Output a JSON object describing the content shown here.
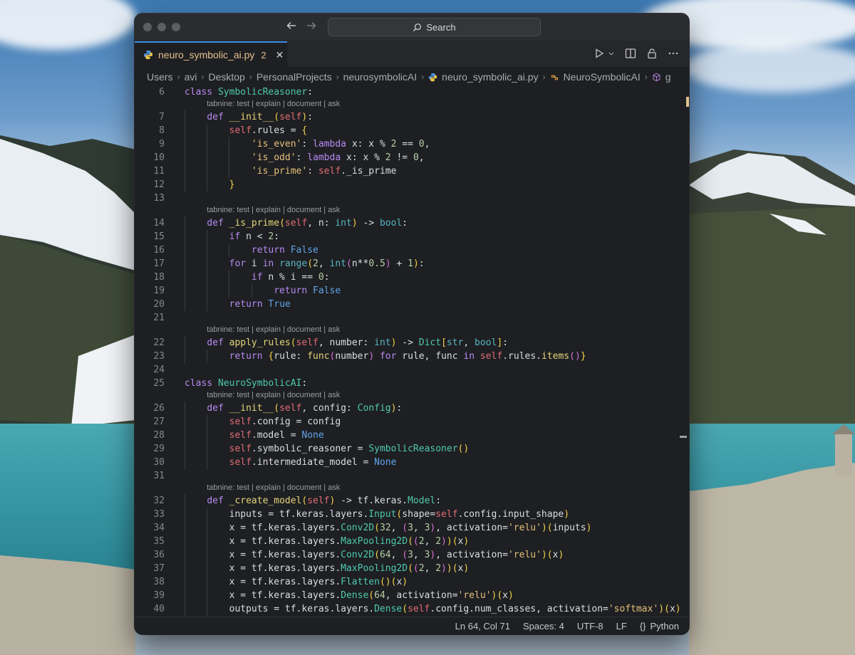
{
  "window": {
    "search_label": "Search"
  },
  "tab": {
    "filename": "neuro_symbolic_ai.py",
    "problem_count": "2",
    "close_glyph": "✕"
  },
  "breadcrumb": {
    "items": [
      "Users",
      "avi",
      "Desktop",
      "PersonalProjects",
      "neurosymbolicAI",
      "neuro_symbolic_ai.py",
      "NeuroSymbolicAI",
      "g"
    ]
  },
  "codelens": {
    "text": "tabnine: test | explain | document | ask"
  },
  "code": {
    "lines": [
      {
        "n": "6",
        "t": "class SymbolicReasoner:"
      },
      {
        "n": "7",
        "t": "    def __init__(self):"
      },
      {
        "n": "8",
        "t": "        self.rules = {"
      },
      {
        "n": "9",
        "t": "            'is_even': lambda x: x % 2 == 0,"
      },
      {
        "n": "10",
        "t": "            'is_odd': lambda x: x % 2 != 0,"
      },
      {
        "n": "11",
        "t": "            'is_prime': self._is_prime"
      },
      {
        "n": "12",
        "t": "        }"
      },
      {
        "n": "13",
        "t": ""
      },
      {
        "n": "14",
        "t": "    def _is_prime(self, n: int) -> bool:"
      },
      {
        "n": "15",
        "t": "        if n < 2:"
      },
      {
        "n": "16",
        "t": "            return False"
      },
      {
        "n": "17",
        "t": "        for i in range(2, int(n**0.5) + 1):"
      },
      {
        "n": "18",
        "t": "            if n % i == 0:"
      },
      {
        "n": "19",
        "t": "                return False"
      },
      {
        "n": "20",
        "t": "        return True"
      },
      {
        "n": "21",
        "t": ""
      },
      {
        "n": "22",
        "t": "    def apply_rules(self, number: int) -> Dict[str, bool]:"
      },
      {
        "n": "23",
        "t": "        return {rule: func(number) for rule, func in self.rules.items()}"
      },
      {
        "n": "24",
        "t": ""
      },
      {
        "n": "25",
        "t": "class NeuroSymbolicAI:"
      },
      {
        "n": "26",
        "t": "    def __init__(self, config: Config):"
      },
      {
        "n": "27",
        "t": "        self.config = config"
      },
      {
        "n": "28",
        "t": "        self.model = None"
      },
      {
        "n": "29",
        "t": "        self.symbolic_reasoner = SymbolicReasoner()"
      },
      {
        "n": "30",
        "t": "        self.intermediate_model = None"
      },
      {
        "n": "31",
        "t": ""
      },
      {
        "n": "32",
        "t": "    def _create_model(self) -> tf.keras.Model:"
      },
      {
        "n": "33",
        "t": "        inputs = tf.keras.layers.Input(shape=self.config.input_shape)"
      },
      {
        "n": "34",
        "t": "        x = tf.keras.layers.Conv2D(32, (3, 3), activation='relu')(inputs)"
      },
      {
        "n": "35",
        "t": "        x = tf.keras.layers.MaxPooling2D((2, 2))(x)"
      },
      {
        "n": "36",
        "t": "        x = tf.keras.layers.Conv2D(64, (3, 3), activation='relu')(x)"
      },
      {
        "n": "37",
        "t": "        x = tf.keras.layers.MaxPooling2D((2, 2))(x)"
      },
      {
        "n": "38",
        "t": "        x = tf.keras.layers.Flatten()(x)"
      },
      {
        "n": "39",
        "t": "        x = tf.keras.layers.Dense(64, activation='relu')(x)"
      },
      {
        "n": "40",
        "t": "        outputs = tf.keras.layers.Dense(self.config.num_classes, activation='softmax')(x)"
      }
    ]
  },
  "status": {
    "position": "Ln 64, Col 71",
    "indent": "Spaces: 4",
    "encoding": "UTF-8",
    "eol": "LF",
    "language_glyph": "{}",
    "language": "Python"
  },
  "colors": {
    "tab_accent": "#3b8eea",
    "modified_tab_text": "#e2c08d",
    "editor_bg": "#1e1f22"
  },
  "icons": [
    "back-arrow-icon",
    "forward-arrow-icon",
    "search-icon",
    "python-file-icon",
    "close-icon",
    "run-icon",
    "chevron-down-icon",
    "split-editor-icon",
    "lock-icon",
    "more-icon",
    "symbol-class-icon",
    "symbol-method-icon",
    "braces-icon"
  ]
}
